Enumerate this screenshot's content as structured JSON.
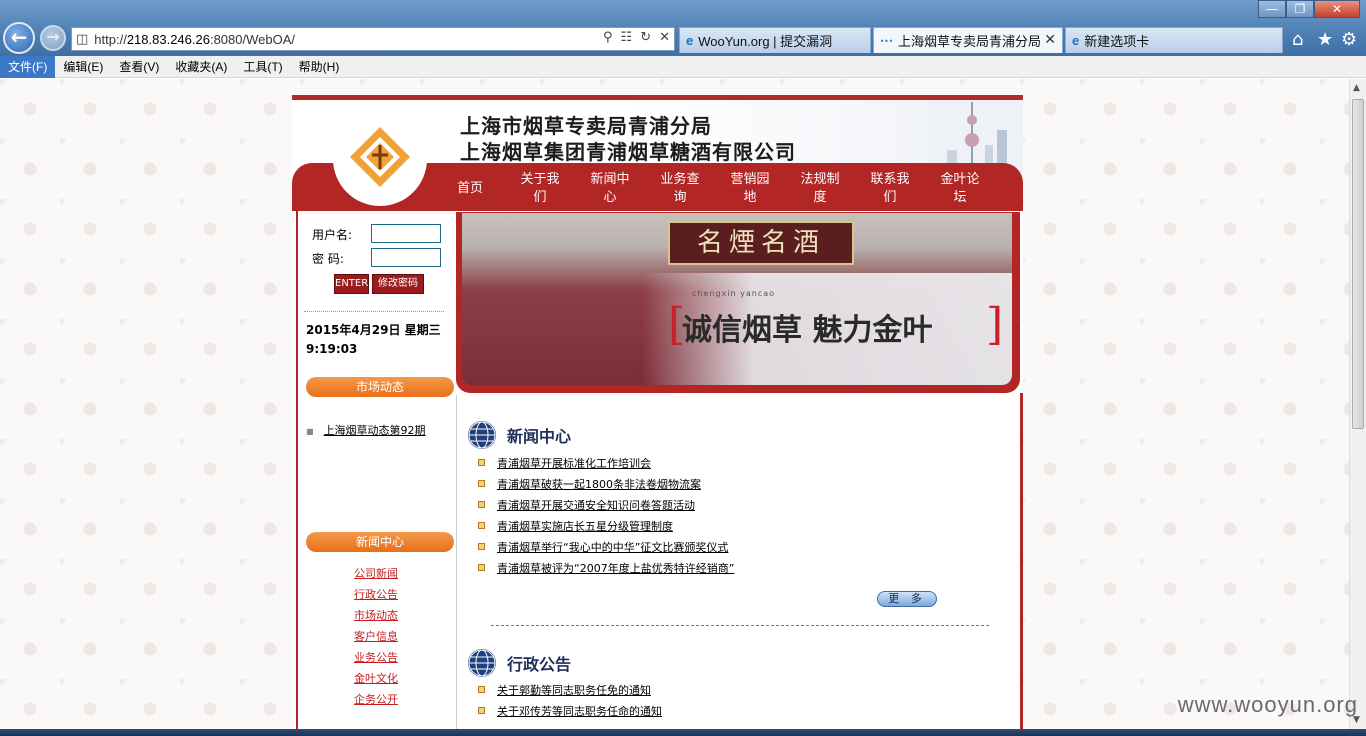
{
  "browser": {
    "url_prefix": "http://",
    "url_host": "218.83.246.26",
    "url_rest": ":8080/WebOA/",
    "tabs": [
      {
        "label": "WooYun.org | 提交漏洞"
      },
      {
        "label": "上海烟草专卖局青浦分局"
      },
      {
        "label": "新建选项卡"
      }
    ],
    "menu": [
      "文件(F)",
      "编辑(E)",
      "查看(V)",
      "收藏夹(A)",
      "工具(T)",
      "帮助(H)"
    ]
  },
  "site": {
    "title_line1": "上海市烟草专卖局青浦分局",
    "title_line2": "上海烟草集团青浦烟草糖酒有限公司",
    "nav": [
      "首页",
      "关于我们",
      "新闻中心",
      "业务查询",
      "营销园地",
      "法规制度",
      "联系我们",
      "金叶论坛"
    ],
    "nav_display": [
      "首页",
      "关于我\n们",
      "新闻中\n心",
      "业务查\n询",
      "营销园\n地",
      "法规制\n度",
      "联系我\n们",
      "金叶论\n坛"
    ]
  },
  "login": {
    "username_label": "用户名:",
    "password_label": "密  码:",
    "enter_label": "ENTER",
    "change_pwd_label": "修改密码"
  },
  "datetime": {
    "date": "2015年4月29日  星期三",
    "time": "9:19:03"
  },
  "market": {
    "heading": "市场动态",
    "items": [
      "上海烟草动态第92期"
    ]
  },
  "news_center_sidebar": {
    "heading": "新闻中心",
    "links": [
      "公司新闻",
      "行政公告",
      "市场动态",
      "客户信息",
      "业务公告",
      "金叶文化",
      "企务公开"
    ]
  },
  "banner": {
    "sign": "名煙名酒",
    "pinyin": "chengxin yancao",
    "slogan": "诚信烟草  魅力金叶",
    "bracket_left": "[",
    "bracket_right": "]"
  },
  "news_section": {
    "title": "新闻中心",
    "items": [
      "青浦烟草开展标准化工作培训会",
      "青浦烟草破获一起1800条非法卷烟物流案",
      "青浦烟草开展交通安全知识问卷答题活动",
      "青浦烟草实施店长五星分级管理制度",
      "青浦烟草举行“我心中的中华”征文比赛颁奖仪式",
      "青浦烟草被评为“2007年度上盐优秀特许经销商”"
    ],
    "more_label": "更 多"
  },
  "notice_section": {
    "title": "行政公告",
    "items": [
      "关于郭勤等同志职务任免的通知",
      "关于邓传芳等同志职务任命的通知"
    ]
  },
  "watermark": "www.wooyun.org"
}
